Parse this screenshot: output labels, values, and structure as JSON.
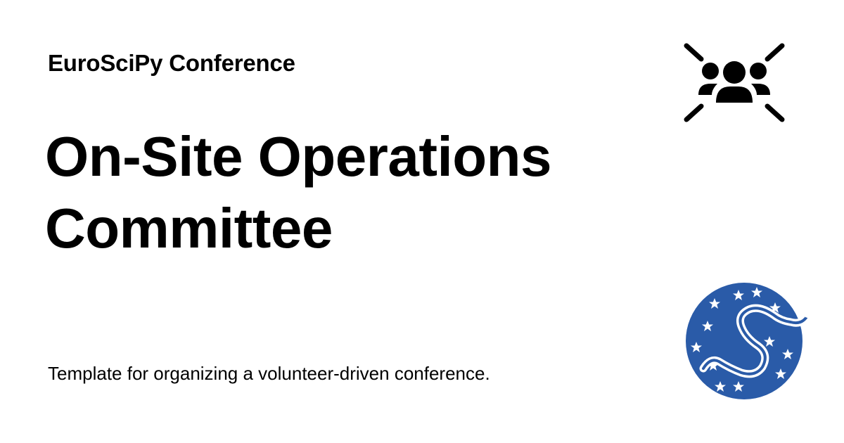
{
  "header": {
    "site_name": "EuroSciPy Conference"
  },
  "main": {
    "title": "On-Site Operations Committee",
    "description": "Template for organizing a volunteer-driven conference."
  },
  "icons": {
    "group": "group-focus-icon",
    "logo": "scipy-logo"
  },
  "colors": {
    "background": "#ffffff",
    "text": "#000000",
    "logo_blue": "#2a5ba8"
  }
}
